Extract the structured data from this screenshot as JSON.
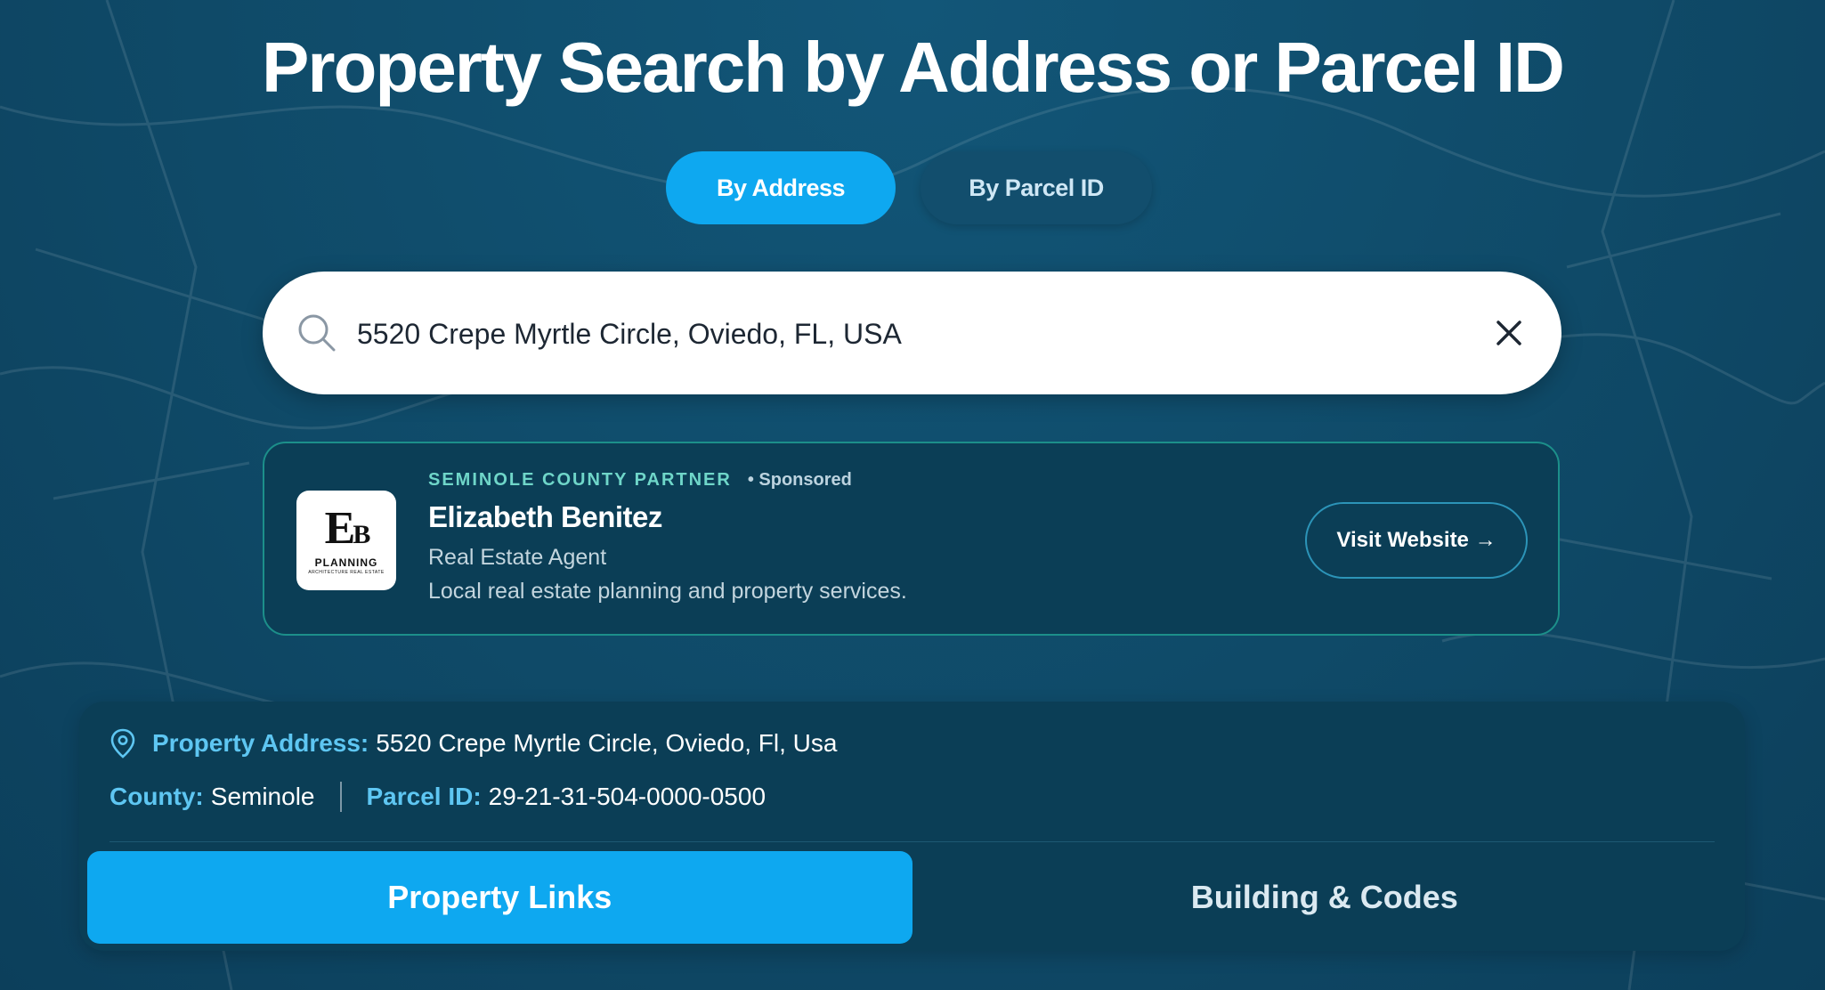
{
  "page": {
    "title": "Property Search by Address or Parcel ID"
  },
  "search_tabs": {
    "by_address": "By Address",
    "by_parcel_id": "By Parcel ID",
    "active": "by_address"
  },
  "search": {
    "value": "5520 Crepe Myrtle Circle, Oviedo, FL, USA",
    "search_icon": "search-icon",
    "clear_icon": "close-icon"
  },
  "partner": {
    "kicker": "SEMINOLE COUNTY PARTNER",
    "sponsored": "• Sponsored",
    "name": "Elizabeth Benitez",
    "role": "Real Estate Agent",
    "description": "Local real estate planning and property services.",
    "logo": {
      "mark_e": "E",
      "mark_b": "B",
      "word": "PLANNING",
      "sub": "ARCHITECTURE REAL ESTATE"
    },
    "button_label": "Visit Website →"
  },
  "property": {
    "address_label": "Property Address:",
    "address_value": "5520 Crepe Myrtle Circle, Oviedo, Fl, Usa",
    "county_label": "County:",
    "county_value": "Seminole",
    "parcel_label": "Parcel ID:",
    "parcel_value": "29-21-31-504-0000-0500",
    "pin_icon": "map-pin-icon"
  },
  "result_tabs": {
    "property_links": "Property Links",
    "building_codes": "Building & Codes",
    "active": "property_links"
  },
  "colors": {
    "background": "#0f4c6b",
    "accent": "#0ea8f0",
    "panel": "#0b3e56",
    "label": "#5ec6f2",
    "partner_kicker": "#6fd6c9"
  }
}
